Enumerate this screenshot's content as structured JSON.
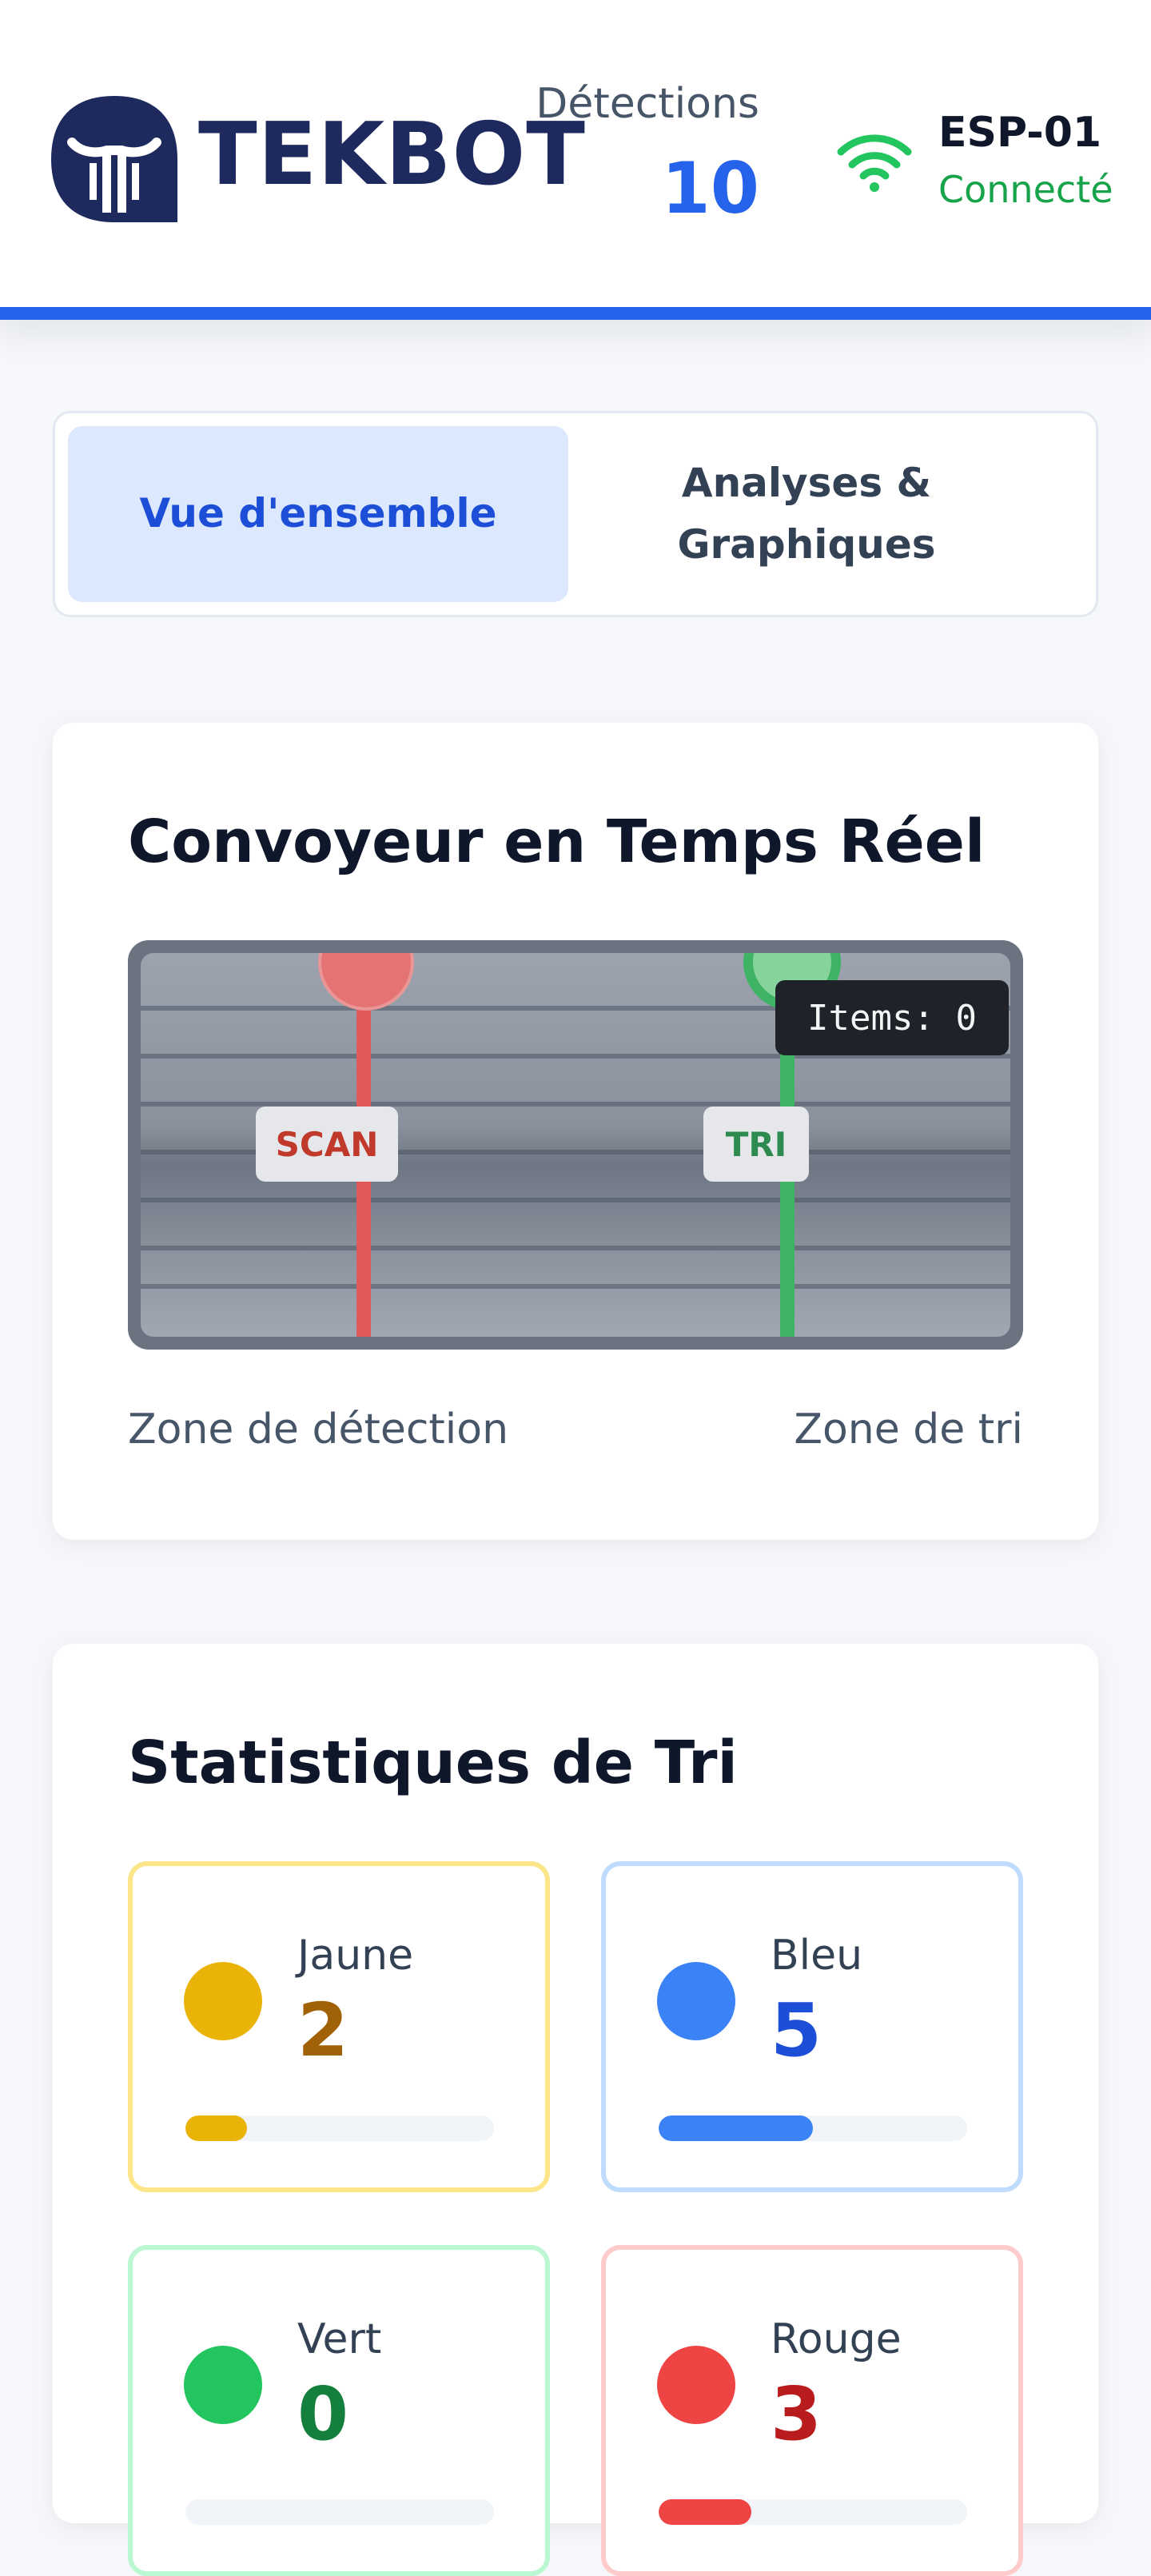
{
  "header": {
    "brand": "TEKBOT",
    "detections_label": "Détections",
    "detections_value": "10",
    "device_name": "ESP-01",
    "device_status": "Connecté"
  },
  "tabs": [
    {
      "label": "Vue d'ensemble",
      "active": true
    },
    {
      "label": "Analyses & Graphiques",
      "active": false
    }
  ],
  "conveyor": {
    "title": "Convoyeur en Temps Réel",
    "scan_label": "SCAN",
    "sort_label": "TRI",
    "items_counter": "Items: 0",
    "zone_detection": "Zone de détection",
    "zone_sort": "Zone de tri",
    "colors": {
      "scan": "#ef4444",
      "sort": "#22c55e"
    }
  },
  "stats": {
    "title": "Statistiques de Tri",
    "items": [
      {
        "label": "Jaune",
        "value": "2",
        "fraction": 0.2,
        "color": "#eab308",
        "text_color": "#a16207",
        "border": "#fde68a"
      },
      {
        "label": "Bleu",
        "value": "5",
        "fraction": 0.5,
        "color": "#3b82f6",
        "text_color": "#1d4ed8",
        "border": "#bfdbfe"
      },
      {
        "label": "Vert",
        "value": "0",
        "fraction": 0.0,
        "color": "#22c55e",
        "text_color": "#15803d",
        "border": "#bbf7d0"
      },
      {
        "label": "Rouge",
        "value": "3",
        "fraction": 0.3,
        "color": "#ef4444",
        "text_color": "#b91c1c",
        "border": "#fecaca"
      }
    ]
  }
}
